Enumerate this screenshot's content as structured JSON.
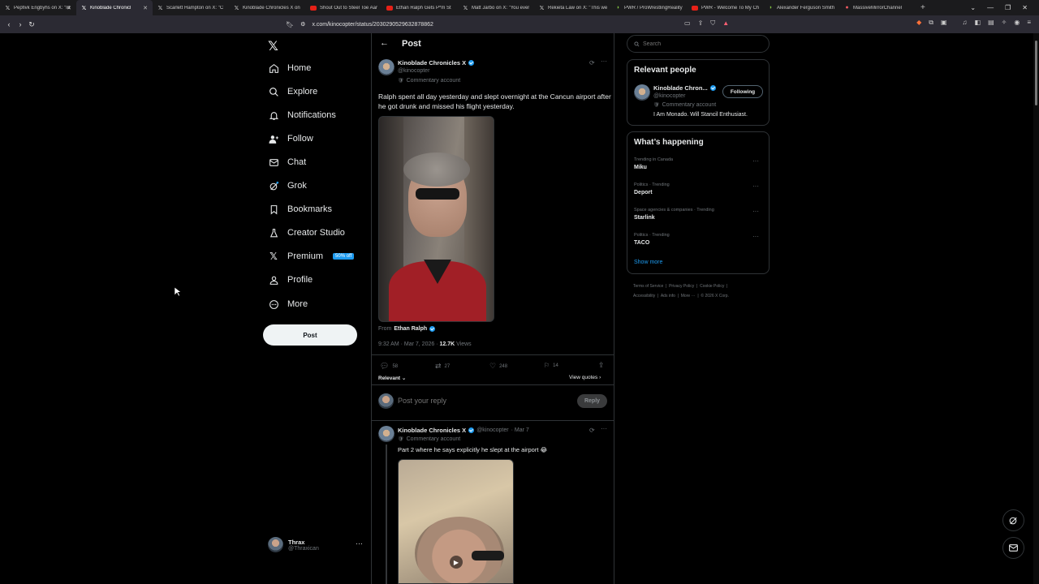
{
  "browser": {
    "tabs": [
      {
        "title": "Pepfivk Engbyhs on X: \"Id",
        "icon": "x-logo-icon"
      },
      {
        "title": "Kinoblade Chronicl",
        "icon": "x-logo-icon",
        "active": true
      },
      {
        "title": "Scarlett Hampton on X: \"C",
        "icon": "x-logo-icon"
      },
      {
        "title": "Kinoblade Chronicles X on",
        "icon": "x-logo-icon"
      },
      {
        "title": "Shout Out to Steel Toe Aar",
        "icon": "youtube-icon"
      },
      {
        "title": "Ethan Ralph Gets P*m St",
        "icon": "youtube-icon"
      },
      {
        "title": "Matt Jarbo on X: \"You ever",
        "icon": "x-logo-icon"
      },
      {
        "title": "Rekieta Law on X: \"This we",
        "icon": "x-logo-icon"
      },
      {
        "title": "PWR / ProWrestlingReality",
        "icon": "rumble-icon"
      },
      {
        "title": "PWR - Welcome To My Ch",
        "icon": "youtube-icon"
      },
      {
        "title": "Alexander Ferguson Smith",
        "icon": "rumble-icon"
      },
      {
        "title": "MassiveMirrorChannel",
        "icon": "channel-icon"
      }
    ],
    "url": "x.com/kinocopter/status/2030290529632878862"
  },
  "sidebar": {
    "items": [
      {
        "label": "Home",
        "icon": "home-icon"
      },
      {
        "label": "Explore",
        "icon": "search-icon"
      },
      {
        "label": "Notifications",
        "icon": "bell-icon"
      },
      {
        "label": "Follow",
        "icon": "follow-icon"
      },
      {
        "label": "Chat",
        "icon": "chat-icon"
      },
      {
        "label": "Grok",
        "icon": "grok-icon"
      },
      {
        "label": "Bookmarks",
        "icon": "bookmark-icon"
      },
      {
        "label": "Creator Studio",
        "icon": "creator-studio-icon"
      },
      {
        "label": "Premium",
        "icon": "x-logo-icon"
      },
      {
        "label": "Profile",
        "icon": "profile-icon"
      },
      {
        "label": "More",
        "icon": "more-icon"
      }
    ],
    "premium_badge": "50% off",
    "post_button": "Post",
    "account": {
      "name": "Thrax",
      "handle": "@Thraxican"
    }
  },
  "main": {
    "header": "Post",
    "tweet": {
      "name": "Kinoblade Chronicles X",
      "handle": "@kinocopter",
      "account_label": "Commentary account",
      "text": "Ralph spent all day yesterday and slept overnight at the Cancun airport after he got drunk and missed his flight yesterday.",
      "from_label": "From",
      "from_name": "Ethan Ralph",
      "timestamp": "9:32 AM · Mar 7, 2026 · ",
      "views_count": "12.7K",
      "views_label": " Views",
      "replies": "58",
      "reposts": "27",
      "likes": "248",
      "bookmarks": "14",
      "sort_label": "Relevant",
      "view_quotes": "View quotes"
    },
    "reply_box": {
      "placeholder": "Post your reply",
      "button": "Reply"
    },
    "reply": {
      "name": "Kinoblade Chronicles X",
      "handle": "@kinocopter",
      "date": "· Mar 7",
      "account_label": "Commentary account",
      "text": "Part 2 where he says explicitly he slept at the airport 😂"
    }
  },
  "right": {
    "search_placeholder": "Search",
    "relevant_people": {
      "title": "Relevant people",
      "name": "Kinoblade Chron...",
      "handle": "@kinocopter",
      "account_label": "Commentary account",
      "bio": "I Am Monado. Will Stancil Enthusiast.",
      "button": "Following"
    },
    "happening": {
      "title": "What’s happening",
      "trends": [
        {
          "context": "Trending in Canada",
          "topic": "Miku"
        },
        {
          "context": "Politics · Trending",
          "topic": "Deport"
        },
        {
          "context": "Space agencies & companies · Trending",
          "topic": "Starlink"
        },
        {
          "context": "Politics · Trending",
          "topic": "TACO"
        }
      ],
      "show_more": "Show more"
    },
    "footer": {
      "terms": "Terms of Service",
      "privacy": "Privacy Policy",
      "cookie": "Cookie Policy",
      "accessibility": "Accessibility",
      "ads": "Ads info",
      "more": "More ···",
      "copyright": "© 2026 X Corp."
    }
  }
}
